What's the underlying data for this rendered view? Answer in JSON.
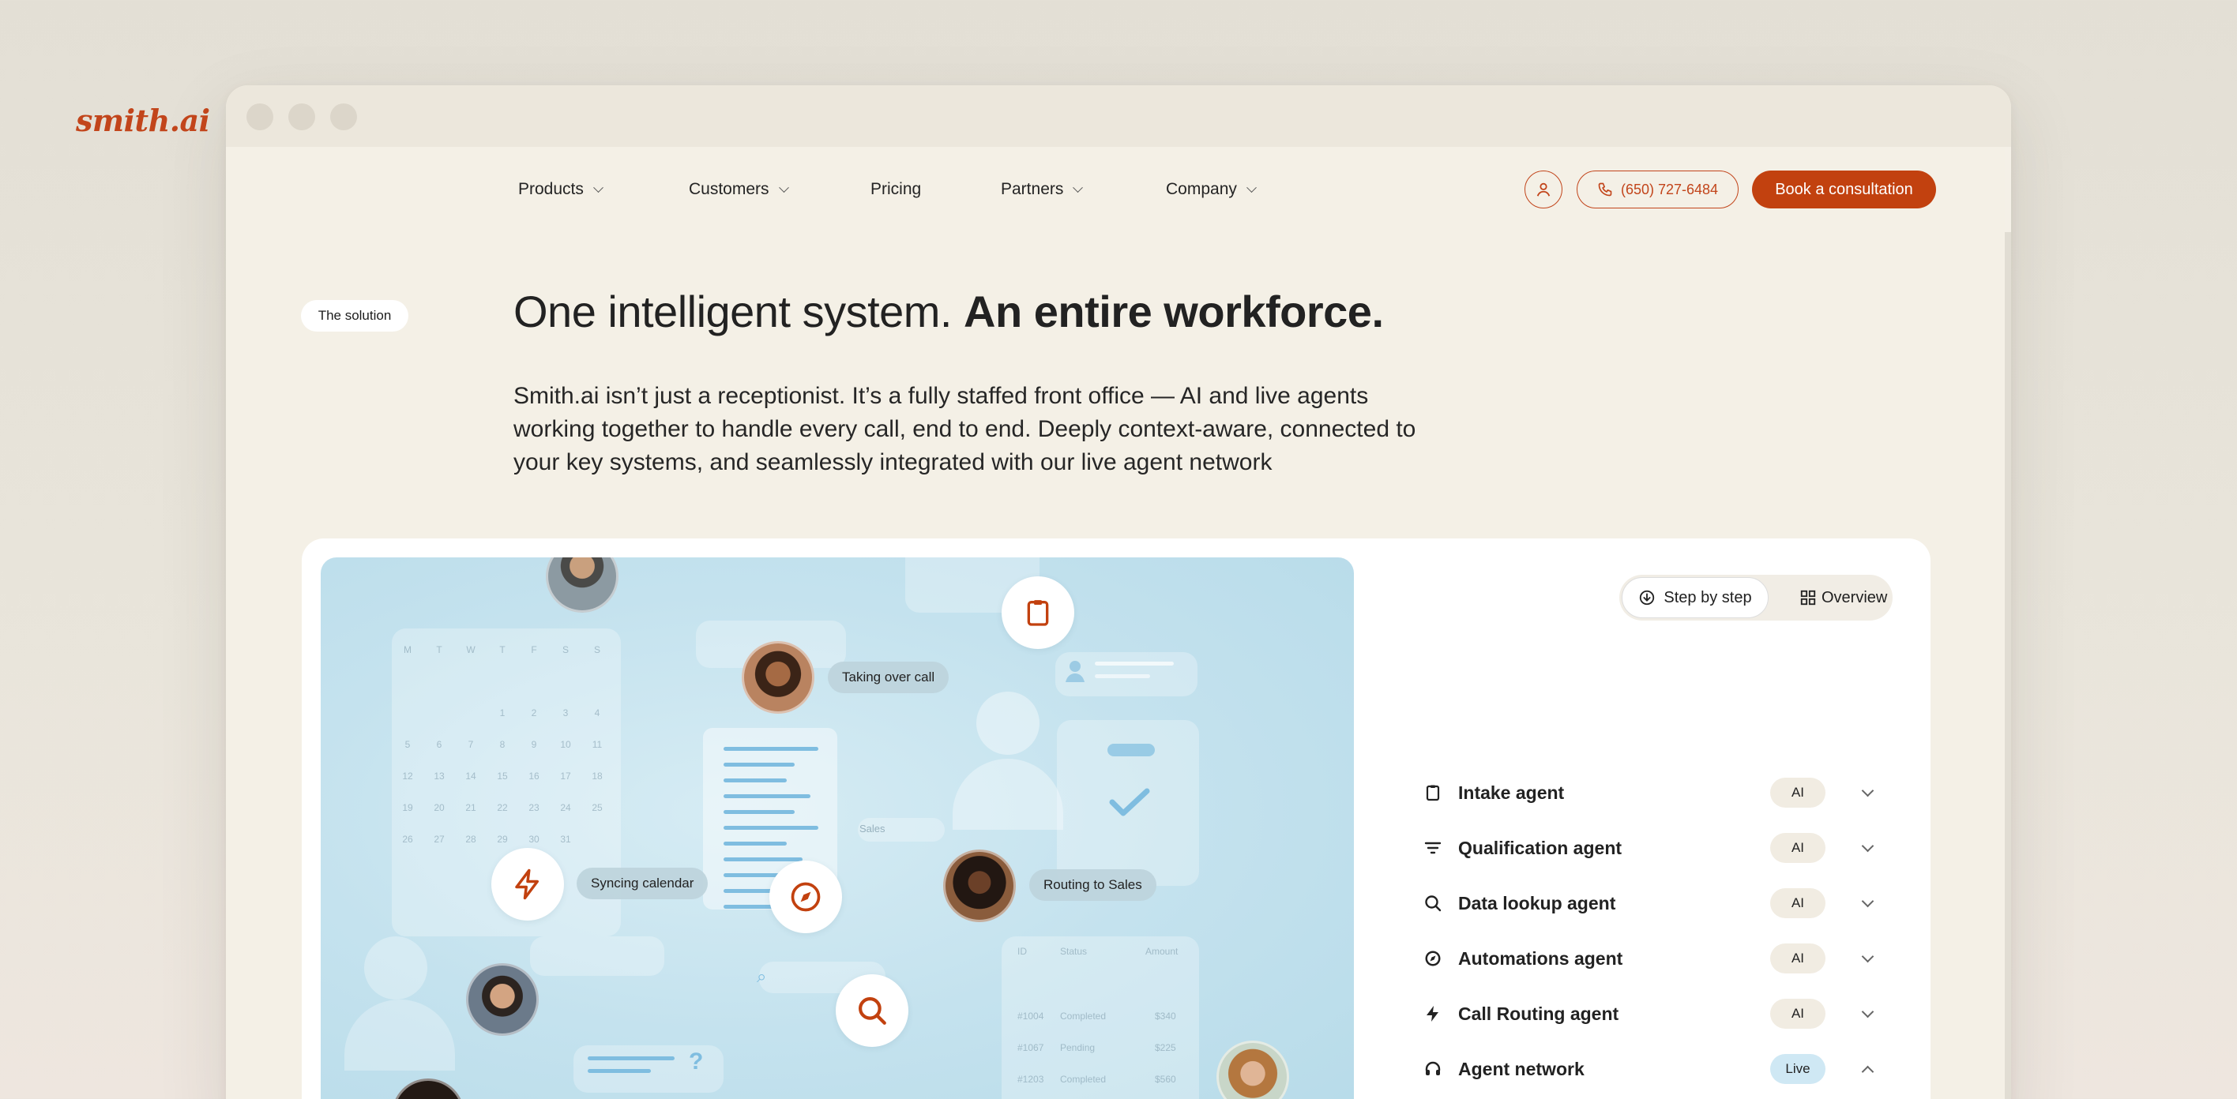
{
  "nav": {
    "logo": "smith.ai",
    "items": [
      {
        "label": "Products",
        "dropdown": true
      },
      {
        "label": "Customers",
        "dropdown": true
      },
      {
        "label": "Pricing",
        "dropdown": false
      },
      {
        "label": "Partners",
        "dropdown": true
      },
      {
        "label": "Company",
        "dropdown": true
      }
    ],
    "phone": "(650) 727-6484",
    "cta": "Book a consultation"
  },
  "hero": {
    "tag": "The solution",
    "headline_light": "One intelligent system.",
    "headline_bold": "An entire workforce.",
    "lead": "Smith.ai isn’t just a receptionist. It’s a fully staffed front office — AI and live agents working together to handle every call, end to end. Deeply context-aware, connected to your key systems, and seamlessly integrated with our live agent network"
  },
  "illustration": {
    "labels": {
      "taking_over": "Taking over call",
      "syncing": "Syncing calendar",
      "routing": "Routing to Sales",
      "sales_tag": "Sales"
    },
    "calendar": {
      "days": [
        "M",
        "T",
        "W",
        "T",
        "F",
        "S",
        "S"
      ],
      "weeks": [
        [
          "",
          "",
          "",
          "1",
          "2",
          "3",
          "4"
        ],
        [
          "5",
          "6",
          "7",
          "8",
          "9",
          "10",
          "11"
        ],
        [
          "12",
          "13",
          "14",
          "15",
          "16",
          "17",
          "18"
        ],
        [
          "19",
          "20",
          "21",
          "22",
          "23",
          "24",
          "25"
        ],
        [
          "26",
          "27",
          "28",
          "29",
          "30",
          "31",
          ""
        ]
      ]
    },
    "table": {
      "headers": [
        "ID",
        "Status",
        "Amount"
      ],
      "rows": [
        [
          "#1004",
          "Completed",
          "$340"
        ],
        [
          "#1067",
          "Pending",
          "$225"
        ],
        [
          "#1203",
          "Completed",
          "$560"
        ]
      ]
    }
  },
  "view_toggle": {
    "step": "Step by step",
    "overview": "Overview"
  },
  "agents": [
    {
      "name": "Intake agent",
      "badge": "AI",
      "icon": "clipboard-icon",
      "expanded": false
    },
    {
      "name": "Qualification agent",
      "badge": "AI",
      "icon": "filter-icon",
      "expanded": false
    },
    {
      "name": "Data lookup agent",
      "badge": "AI",
      "icon": "search-icon",
      "expanded": false
    },
    {
      "name": "Automations agent",
      "badge": "AI",
      "icon": "compass-icon",
      "expanded": false
    },
    {
      "name": "Call Routing agent",
      "badge": "AI",
      "icon": "bolt-icon",
      "expanded": false
    },
    {
      "name": "Agent network",
      "badge": "Live",
      "icon": "headset-icon",
      "expanded": true
    }
  ],
  "colors": {
    "brand": "#c2410f",
    "background": "#f4f0e6",
    "illustration_bg": "#c4e2ee",
    "live_badge": "#cfe8f4"
  }
}
